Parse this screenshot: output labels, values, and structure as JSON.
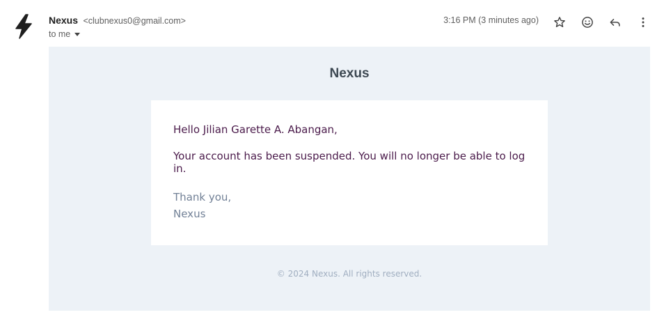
{
  "header": {
    "sender_name": "Nexus",
    "sender_email": "<clubnexus0@gmail.com>",
    "recipient": "to me",
    "timestamp": "3:16 PM (3 minutes ago)",
    "actions": [
      "star-icon",
      "emoji-icon",
      "reply-icon",
      "more-vert-icon"
    ]
  },
  "avatar": {
    "icon": "lightning-bolt-icon"
  },
  "email": {
    "brand_title": "Nexus",
    "greeting": "Hello Jilian Garette A. Abangan,",
    "message": "Your account has been suspended. You will no longer be able to log in.",
    "signoff_line1": "Thank you,",
    "signoff_line2": "Nexus",
    "footer": "© 2024 Nexus. All rights reserved."
  },
  "colors": {
    "body_background": "#edf2f7",
    "brand_title": "#3d4852",
    "message_text": "#4a1a4a",
    "signoff_text": "#718096",
    "footer_text": "#a0aec0"
  }
}
